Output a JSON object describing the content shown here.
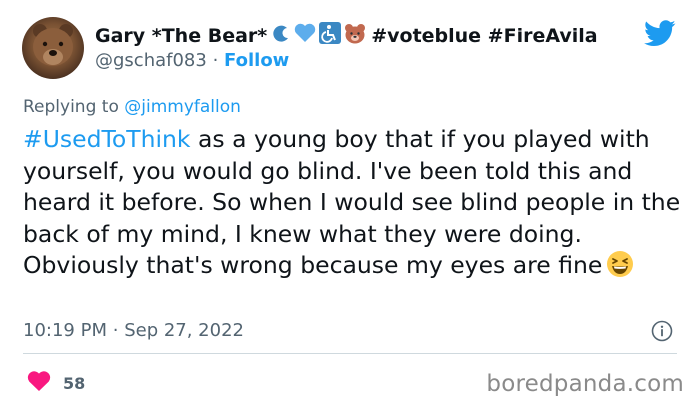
{
  "author": {
    "display_name": "Gary *The Bear*",
    "name_suffix": "#voteblue #FireAvila",
    "name_emojis": [
      "wave-emoji",
      "blue-heart-emoji",
      "wheelchair-emoji",
      "bear-emoji"
    ],
    "handle": "@gschaf083",
    "separator": "·",
    "follow_label": "Follow"
  },
  "reply": {
    "prefix": "Replying to",
    "user": "@jimmyfallon"
  },
  "tweet": {
    "hashtag": "#UsedToThink",
    "text": " as a young boy that if you played with yourself, you would go blind. I've been told this and heard it before. So when I would see blind people in the back of my mind, I knew what they were doing. Obviously  that's wrong because my eyes are fine",
    "trailing_emoji": "grinning-squinting-face-emoji"
  },
  "meta": {
    "time": "10:19 PM",
    "separator": "·",
    "date": "Sep 27, 2022"
  },
  "engagement": {
    "likes": "58"
  },
  "watermark": "boredpanda.com",
  "icons": {
    "platform": "twitter-bird-icon",
    "info": "info-icon",
    "like": "heart-icon"
  },
  "colors": {
    "accent": "#1d9bf0",
    "like": "#f91880",
    "secondary_text": "#536471",
    "divider": "#cfd9de"
  }
}
